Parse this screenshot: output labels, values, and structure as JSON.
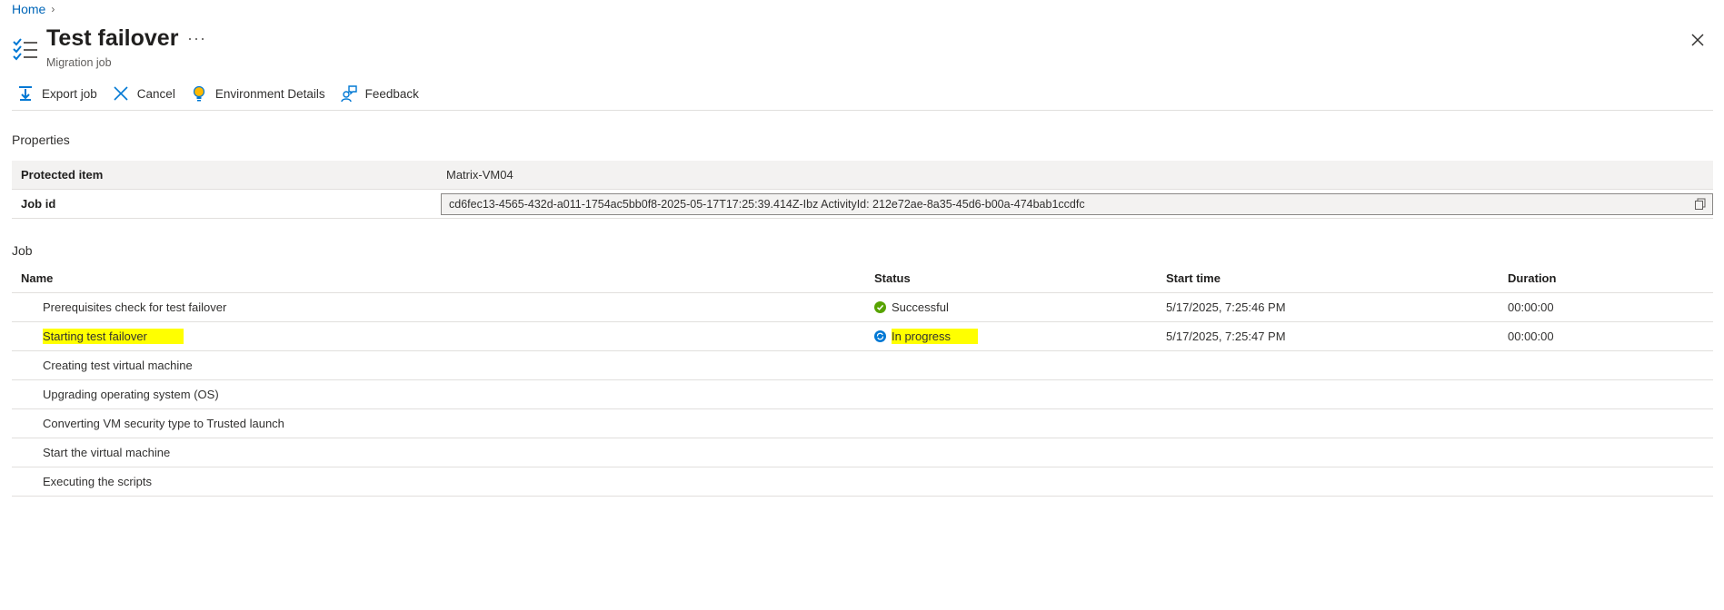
{
  "breadcrumb": {
    "home": "Home"
  },
  "header": {
    "title": "Test failover",
    "subtitle": "Migration job",
    "more": "···"
  },
  "toolbar": {
    "export": "Export job",
    "cancel": "Cancel",
    "environment": "Environment Details",
    "feedback": "Feedback"
  },
  "properties": {
    "section": "Properties",
    "protected_item_label": "Protected item",
    "protected_item_value": "Matrix-VM04",
    "job_id_label": "Job id",
    "job_id_value": "cd6fec13-4565-432d-a011-1754ac5bb0f8-2025-05-17T17:25:39.414Z-Ibz ActivityId: 212e72ae-8a35-45d6-b00a-474bab1ccdfc"
  },
  "job": {
    "section": "Job",
    "columns": {
      "name": "Name",
      "status": "Status",
      "start": "Start time",
      "duration": "Duration"
    },
    "rows": [
      {
        "name": "Prerequisites check for test failover",
        "status": "Successful",
        "start": "5/17/2025, 7:25:46 PM",
        "duration": "00:00:00"
      },
      {
        "name": "Starting test failover",
        "status": "In progress",
        "start": "5/17/2025, 7:25:47 PM",
        "duration": "00:00:00"
      },
      {
        "name": "Creating test virtual machine"
      },
      {
        "name": "Upgrading operating system (OS)"
      },
      {
        "name": "Converting VM security type to Trusted launch"
      },
      {
        "name": "Start the virtual machine"
      },
      {
        "name": "Executing the scripts"
      }
    ]
  },
  "colors": {
    "accent": "#0078d4",
    "success": "#57a300",
    "highlight": "#ffff00"
  }
}
